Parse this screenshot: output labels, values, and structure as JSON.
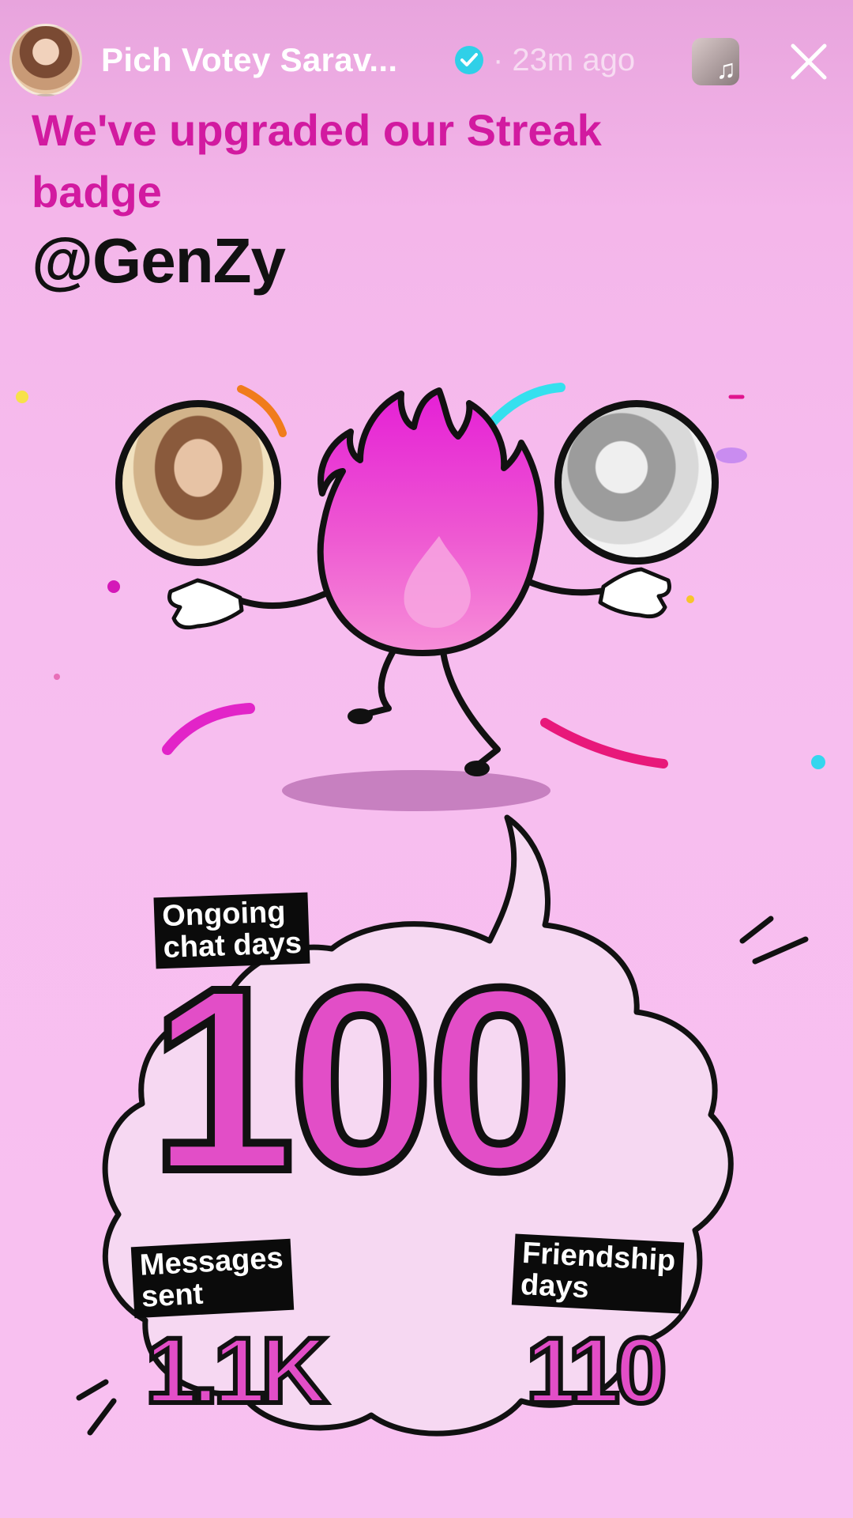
{
  "story_header": {
    "username": "Pich Votey Sarav...",
    "time_ago": "· 23m ago"
  },
  "headline": "We've upgraded our Streak badge",
  "mention": "@GenZy",
  "stats": {
    "ongoing_chat_days_label": "Ongoing chat days",
    "ongoing_chat_days_value": "100",
    "messages_sent_label": "Messages sent",
    "messages_sent_value": "1.1K",
    "friendship_days_label": "Friendship days",
    "friendship_days_value": "110"
  },
  "icons": {
    "verified": "verified-badge-icon",
    "music": "music-note-icon",
    "close": "close-icon",
    "mascot": "flame-mascot"
  },
  "colors": {
    "background": "#f7bdef",
    "headline": "#d21aa0",
    "number_fill": "#e24ec7",
    "verified": "#2fd0e8"
  }
}
